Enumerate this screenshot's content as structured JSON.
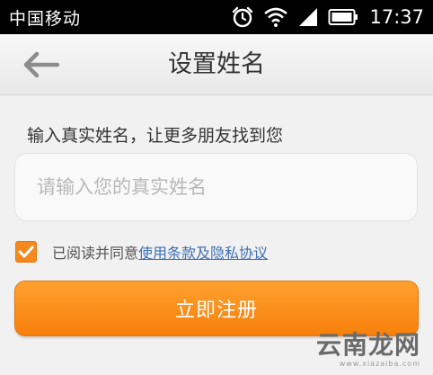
{
  "status_bar": {
    "carrier": "中国移动",
    "time": "17:37"
  },
  "header": {
    "title": "设置姓名"
  },
  "form": {
    "hint": "输入真实姓名，让更多朋友找到您",
    "name_placeholder": "请输入您的真实姓名",
    "name_value": "",
    "agree_checked": true,
    "agree_text": "已阅读并同意",
    "agree_link": "使用条款及隐私协议",
    "submit_label": "立即注册"
  },
  "watermark": {
    "main": "云南龙网",
    "sub": "www.xiazaiba.com"
  },
  "colors": {
    "accent": "#f7870f",
    "link": "#3f6fb5",
    "status_bar": "#000000"
  },
  "icons": [
    "alarm-icon",
    "wifi-icon",
    "signal-icon",
    "battery-icon",
    "back-arrow-icon",
    "checkmark-icon"
  ]
}
